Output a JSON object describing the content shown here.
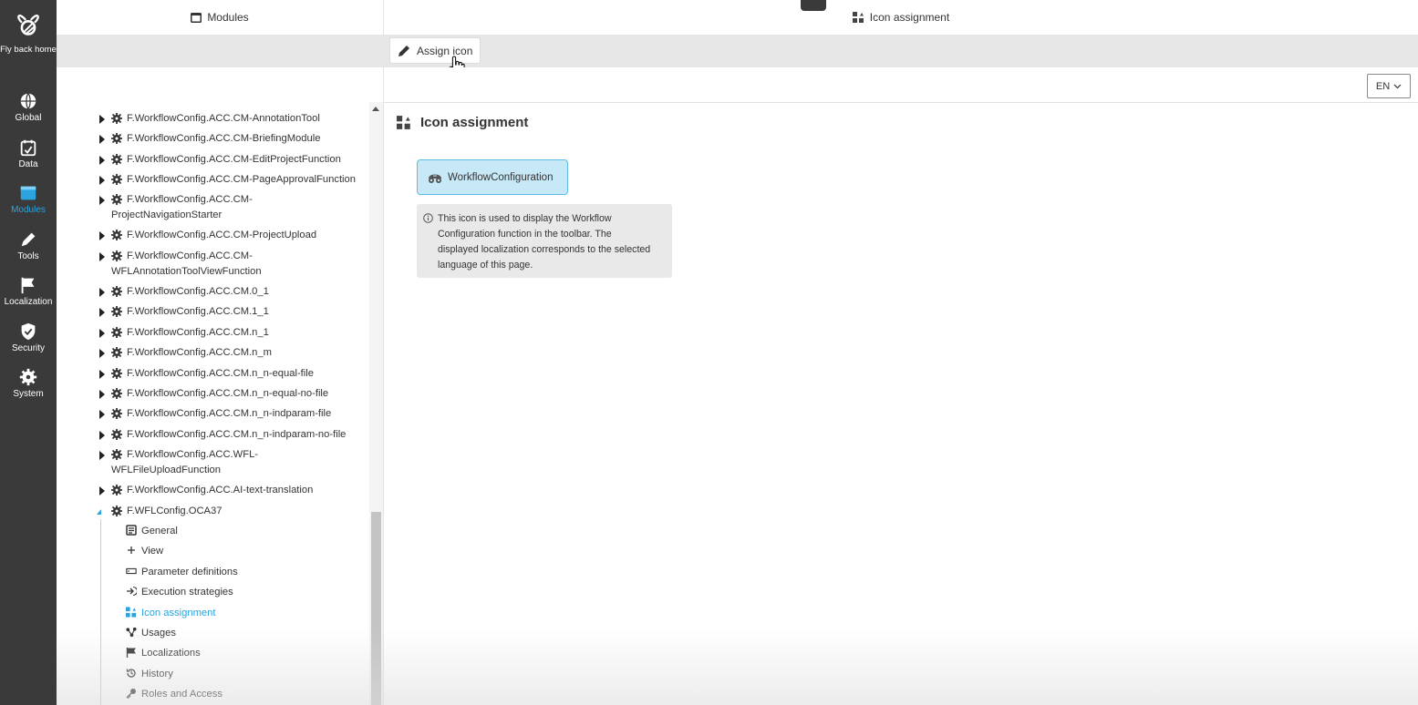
{
  "rail": {
    "logo_label": "Fly back home",
    "items": [
      {
        "label": "Global",
        "icon": "globe-icon"
      },
      {
        "label": "Data",
        "icon": "data-icon"
      },
      {
        "label": "Modules",
        "icon": "modules-icon",
        "active": true
      },
      {
        "label": "Tools",
        "icon": "pencil-icon"
      },
      {
        "label": "Localization",
        "icon": "flag-icon"
      },
      {
        "label": "Security",
        "icon": "shield-icon"
      },
      {
        "label": "System",
        "icon": "gear-icon"
      }
    ]
  },
  "header": {
    "left_tab": "Modules",
    "right_tab": "Icon assignment"
  },
  "toolbar": {
    "assign_label": "Assign icon"
  },
  "language": {
    "value": "EN"
  },
  "tree": {
    "items": [
      {
        "line1": "F.WorkflowConfig.ACC.CM-AnnotationTool"
      },
      {
        "line1": "F.WorkflowConfig.ACC.CM-BriefingModule"
      },
      {
        "line1": "F.WorkflowConfig.ACC.CM-EditProjectFunction"
      },
      {
        "line1": "F.WorkflowConfig.ACC.CM-PageApprovalFunction"
      },
      {
        "line1": "F.WorkflowConfig.ACC.CM-",
        "line2": "ProjectNavigationStarter"
      },
      {
        "line1": "F.WorkflowConfig.ACC.CM-ProjectUpload"
      },
      {
        "line1": "F.WorkflowConfig.ACC.CM-",
        "line2": "WFLAnnotationToolViewFunction"
      },
      {
        "line1": "F.WorkflowConfig.ACC.CM.0_1"
      },
      {
        "line1": "F.WorkflowConfig.ACC.CM.1_1"
      },
      {
        "line1": "F.WorkflowConfig.ACC.CM.n_1"
      },
      {
        "line1": "F.WorkflowConfig.ACC.CM.n_m"
      },
      {
        "line1": "F.WorkflowConfig.ACC.CM.n_n-equal-file"
      },
      {
        "line1": "F.WorkflowConfig.ACC.CM.n_n-equal-no-file"
      },
      {
        "line1": "F.WorkflowConfig.ACC.CM.n_n-indparam-file"
      },
      {
        "line1": "F.WorkflowConfig.ACC.CM.n_n-indparam-no-file"
      },
      {
        "line1": "F.WorkflowConfig.ACC.WFL-",
        "line2": "WFLFileUploadFunction"
      },
      {
        "line1": "F.WorkflowConfig.ACC.AI-text-translation"
      },
      {
        "line1": "F.WFLConfig.OCA37",
        "expanded": true
      }
    ],
    "children": [
      {
        "label": "General",
        "icon": "general-icon"
      },
      {
        "label": "View",
        "icon": "plus-icon"
      },
      {
        "label": "Parameter definitions",
        "icon": "parameter-icon"
      },
      {
        "label": "Execution strategies",
        "icon": "execution-icon"
      },
      {
        "label": "Icon assignment",
        "icon": "icon-assignment-icon",
        "active": true
      },
      {
        "label": "Usages",
        "icon": "usages-icon"
      },
      {
        "label": "Localizations",
        "icon": "flag-icon"
      },
      {
        "label": "History",
        "icon": "history-icon"
      },
      {
        "label": "Roles and Access",
        "icon": "key-icon"
      }
    ]
  },
  "main": {
    "title": "Icon assignment",
    "chip_label": "WorkflowConfiguration",
    "info_lines": [
      "This icon is used to display the Workflow",
      "Configuration function in the toolbar. The",
      "displayed localization corresponds to the selected",
      "language of this page."
    ]
  },
  "colors": {
    "rail_bg": "#3a3a3a",
    "accent": "#2aa3e0",
    "chip_bg": "#c7e8f6",
    "chip_border": "#5bbde6",
    "toolbar_bg": "#e6e6e6"
  }
}
